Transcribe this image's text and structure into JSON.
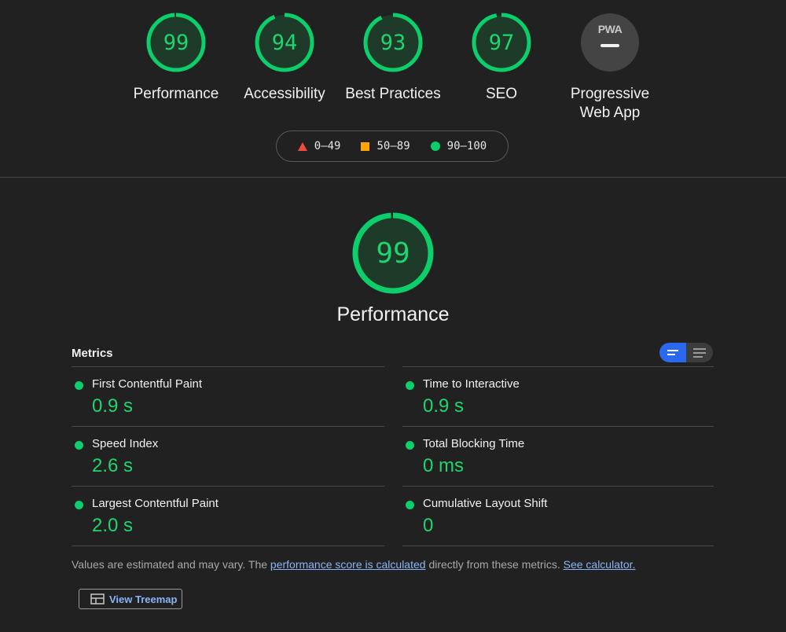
{
  "categories": [
    {
      "score": "99",
      "label": "Performance",
      "fraction": 0.99
    },
    {
      "score": "94",
      "label": "Accessibility",
      "fraction": 0.94
    },
    {
      "score": "93",
      "label": "Best Practices",
      "fraction": 0.93
    },
    {
      "score": "97",
      "label": "SEO",
      "fraction": 0.97
    }
  ],
  "pwa": {
    "badge_text": "PWA",
    "label_line1": "Progressive",
    "label_line2": "Web App"
  },
  "legend": {
    "fail": "0–49",
    "average": "50–89",
    "pass": "90–100"
  },
  "performance": {
    "score": "99",
    "title": "Performance",
    "fraction": 0.99
  },
  "metrics": {
    "header": "Metrics",
    "left": [
      {
        "name": "First Contentful Paint",
        "value": "0.9 s"
      },
      {
        "name": "Speed Index",
        "value": "2.6 s"
      },
      {
        "name": "Largest Contentful Paint",
        "value": "2.0 s"
      }
    ],
    "right": [
      {
        "name": "Time to Interactive",
        "value": "0.9 s"
      },
      {
        "name": "Total Blocking Time",
        "value": "0 ms"
      },
      {
        "name": "Cumulative Layout Shift",
        "value": "0"
      }
    ]
  },
  "note": {
    "prefix": "Values are estimated and may vary. The ",
    "link1": "performance score is calculated",
    "middle": " directly from these metrics. ",
    "link2": "See calculator."
  },
  "treemap_button": "View Treemap",
  "colors": {
    "pass": "#0cce6b",
    "average": "#ffa400",
    "fail": "#ef4c3c",
    "accent": "#2b68f0",
    "link": "#8ab4f8"
  }
}
